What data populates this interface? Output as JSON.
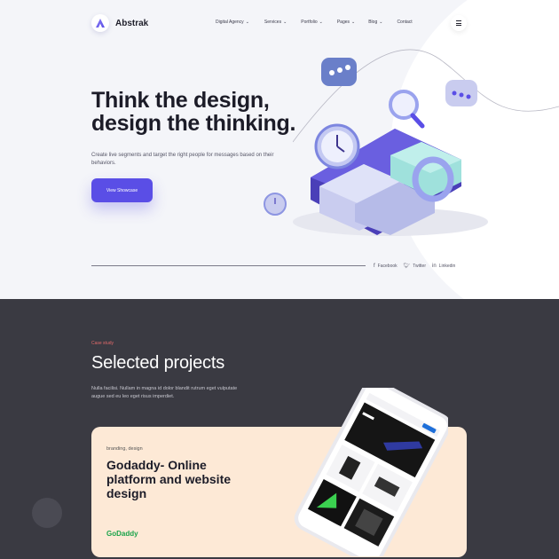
{
  "brand": {
    "name": "Abstrak"
  },
  "nav": {
    "items": [
      {
        "label": "Digital Agency",
        "has_dropdown": true
      },
      {
        "label": "Services",
        "has_dropdown": true
      },
      {
        "label": "Portfolio",
        "has_dropdown": true
      },
      {
        "label": "Pages",
        "has_dropdown": true
      },
      {
        "label": "Blog",
        "has_dropdown": true
      },
      {
        "label": "Contact",
        "has_dropdown": false
      }
    ],
    "menu_icon": "hamburger-icon"
  },
  "hero": {
    "title": "Think the design, design the thinking.",
    "subtitle": "Create live segments and target the right people for messages based on their behaviors.",
    "cta_label": "View Showcase",
    "socials": [
      {
        "label": "Facebook",
        "icon": "facebook-icon"
      },
      {
        "label": "Twitter",
        "icon": "twitter-icon"
      },
      {
        "label": "Linkedin",
        "icon": "linkedin-icon"
      }
    ]
  },
  "projects": {
    "eyebrow": "Case study",
    "title": "Selected projects",
    "description": "Nulla facilisi. Nullam in magna id dolor blandit rutrum eget vulputate augue sed eu leo eget risus imperdiet.",
    "cards": [
      {
        "tags": "branding, design",
        "title": "Godaddy- Online platform and website design",
        "brand": "GoDaddy"
      }
    ]
  },
  "colors": {
    "accent": "#5a4ee6",
    "dark_bg": "#3a3a42",
    "card_bg": "#fde9d6",
    "eyebrow": "#e26a6a",
    "brand_green": "#1aa34a"
  }
}
